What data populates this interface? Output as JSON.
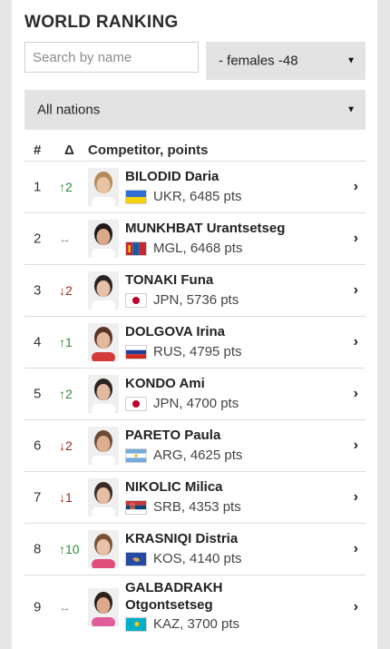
{
  "title": "WORLD RANKING",
  "search": {
    "placeholder": "Search by name"
  },
  "filters": {
    "gender_category": "- females -48",
    "nations": "All nations"
  },
  "table": {
    "headers": {
      "rank": "#",
      "delta": "Δ",
      "competitor": "Competitor, points"
    },
    "rows": [
      {
        "rank": "1",
        "delta": "↑2",
        "delta_dir": "up",
        "name": "BILODID Daria",
        "nation_points": "UKR, 6485 pts",
        "flag_icon": "ukraine-flag-icon"
      },
      {
        "rank": "2",
        "delta": "↔",
        "delta_dir": "same",
        "name": "MUNKHBAT Urantsetseg",
        "nation_points": "MGL, 6468 pts",
        "flag_icon": "mongolia-flag-icon"
      },
      {
        "rank": "3",
        "delta": "↓2",
        "delta_dir": "down",
        "name": "TONAKI Funa",
        "nation_points": "JPN, 5736 pts",
        "flag_icon": "japan-flag-icon"
      },
      {
        "rank": "4",
        "delta": "↑1",
        "delta_dir": "up",
        "name": "DOLGOVA Irina",
        "nation_points": "RUS, 4795 pts",
        "flag_icon": "russia-flag-icon"
      },
      {
        "rank": "5",
        "delta": "↑2",
        "delta_dir": "up",
        "name": "KONDO Ami",
        "nation_points": "JPN, 4700 pts",
        "flag_icon": "japan-flag-icon"
      },
      {
        "rank": "6",
        "delta": "↓2",
        "delta_dir": "down",
        "name": "PARETO Paula",
        "nation_points": "ARG, 4625 pts",
        "flag_icon": "argentina-flag-icon"
      },
      {
        "rank": "7",
        "delta": "↓1",
        "delta_dir": "down",
        "name": "NIKOLIC Milica",
        "nation_points": "SRB, 4353 pts",
        "flag_icon": "serbia-flag-icon"
      },
      {
        "rank": "8",
        "delta": "↑10",
        "delta_dir": "up",
        "name": "KRASNIQI Distria",
        "nation_points": "KOS, 4140 pts",
        "flag_icon": "kosovo-flag-icon"
      },
      {
        "rank": "9",
        "delta": "↔",
        "delta_dir": "same",
        "name": "GALBADRAKH Otgontsetseg",
        "nation_points": "KAZ, 3700 pts",
        "flag_icon": "kazakhstan-flag-icon"
      }
    ]
  },
  "colors": {
    "up": "#2e8b3a",
    "down": "#9b2a1f",
    "select_bg": "#e3e3e3"
  }
}
